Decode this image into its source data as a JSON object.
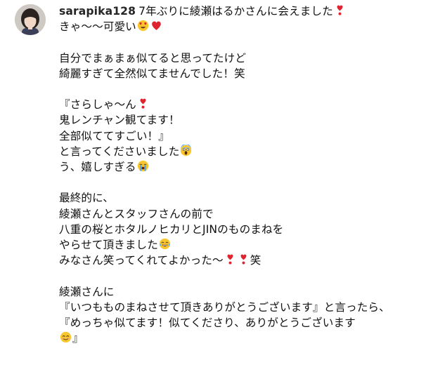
{
  "post": {
    "username": "sarapika128",
    "lines": [
      "7年ぶりに綾瀬はるかさんに会えました",
      "きゃ〜〜可愛い",
      "",
      "自分でまぁまぁ似てると思ってたけど",
      "綺麗すぎて全然似てませんでした！笑",
      "",
      "『さらしゃ〜ん",
      "鬼レンチャン観てます！",
      "全部似ててすごい！』",
      "と言ってくださいました",
      "う、嬉しすぎる",
      "",
      "最終的に、",
      "綾瀬さんとスタッフさんの前で",
      "八重の桜とホタルノヒカリとJINのものまねを",
      "やらせて頂きました",
      "みなさん笑ってくれてよかった〜",
      "笑",
      "",
      "綾瀬さんに",
      "『いつもものまねさせて頂きありがとうございます』と言ったら、",
      "『めっちゃ似てます！似てくださり、ありがとうございます",
      "』"
    ]
  },
  "icons": {
    "avatar": "user-avatar",
    "heart_exclamation": "heavy-heart-exclamation-icon",
    "heart_eyes": "smiling-face-with-heart-eyes-icon",
    "red_heart": "red-heart-icon",
    "screaming": "face-screaming-in-fear-icon",
    "crying": "loudly-crying-face-icon",
    "tears_of_joy": "face-with-tears-of-joy-icon",
    "smiling": "smiling-face-with-smiling-eyes-icon"
  },
  "colors": {
    "text": "#111111",
    "username": "#262626",
    "heart": "#e0242f",
    "emoji_face": "#f8c62f"
  }
}
